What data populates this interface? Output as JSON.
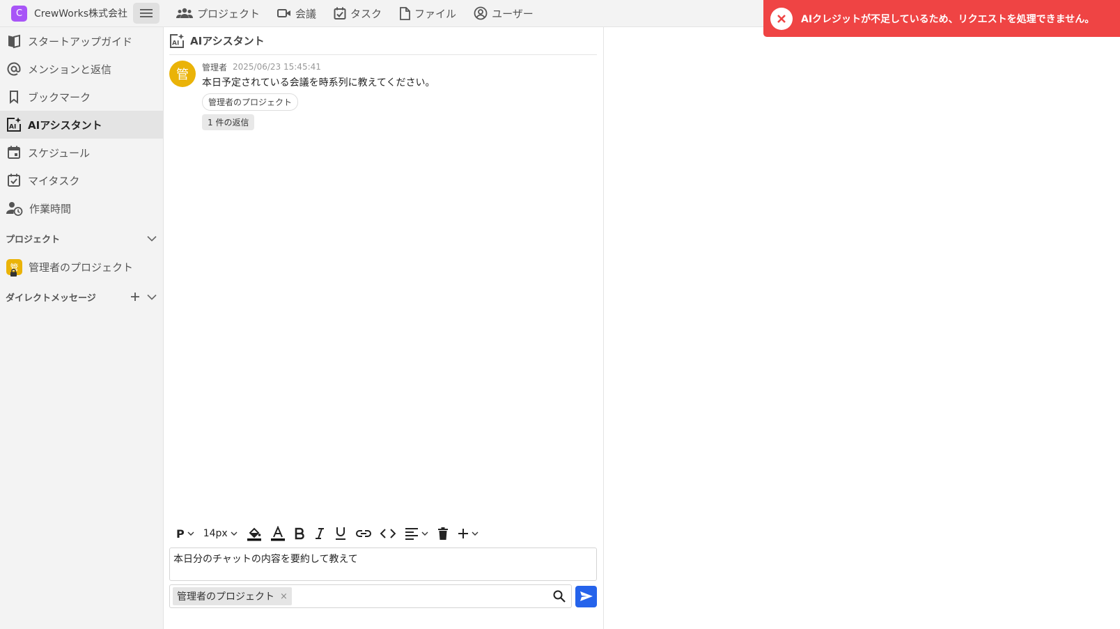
{
  "brand": {
    "badge": "C",
    "name": "CrewWorks株式会社"
  },
  "topnav": [
    {
      "label": "プロジェクト",
      "icon": "group-icon"
    },
    {
      "label": "会議",
      "icon": "video-icon"
    },
    {
      "label": "タスク",
      "icon": "task-icon"
    },
    {
      "label": "ファイル",
      "icon": "file-icon"
    },
    {
      "label": "ユーザー",
      "icon": "user-icon"
    }
  ],
  "sidebar": {
    "items": [
      {
        "label": "スタートアップガイド",
        "icon": "book-icon"
      },
      {
        "label": "メンションと返信",
        "icon": "at-icon"
      },
      {
        "label": "ブックマーク",
        "icon": "bookmark-icon"
      },
      {
        "label": "AIアシスタント",
        "icon": "ai-assistant-icon",
        "active": true
      },
      {
        "label": "スケジュール",
        "icon": "calendar-icon"
      },
      {
        "label": "マイタスク",
        "icon": "task-icon"
      },
      {
        "label": "作業時間",
        "icon": "person-clock-icon"
      }
    ],
    "projects_section": "プロジェクト",
    "projects": [
      {
        "label": "管理者のプロジェクト",
        "badge": "管"
      }
    ],
    "dm_section": "ダイレクトメッセージ"
  },
  "chat": {
    "title": "AIアシスタント",
    "message": {
      "avatar": "管",
      "author": "管理者",
      "time": "2025/06/23 15:45:41",
      "text": "本日予定されている会議を時系列に教えてください。",
      "project_tag": "管理者のプロジェクト",
      "reply_count": "1 件の返信"
    }
  },
  "editor": {
    "paragraph": "P",
    "font_size": "14px",
    "content": "本日分のチャットの内容を要約して教えて",
    "selected_project": "管理者のプロジェクト",
    "remove_glyph": "×"
  },
  "toast": {
    "message": "AIクレジットが不足しているため、リクエストを処理できません。",
    "color": "#ef4444"
  },
  "colors": {
    "accent": "#2563eb",
    "brand": "#a855f7",
    "project": "#eab308"
  }
}
